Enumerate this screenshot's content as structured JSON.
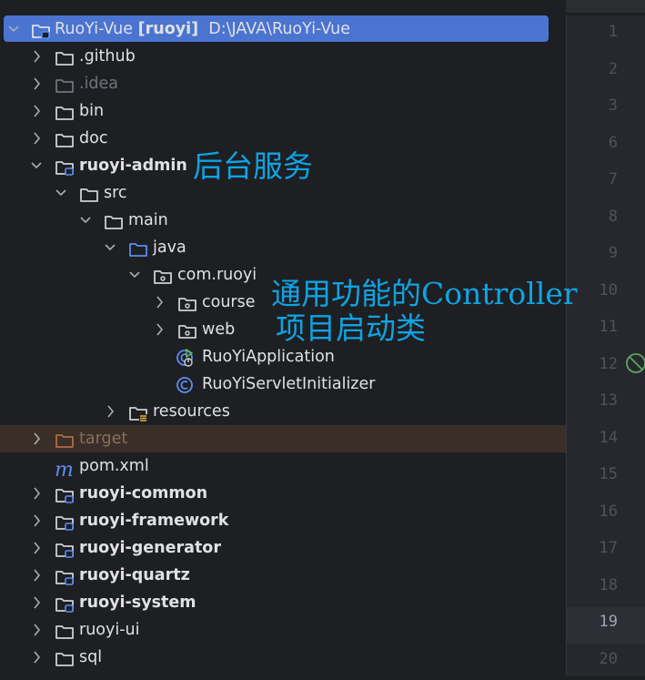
{
  "tree": {
    "root": {
      "name": "RuoYi-Vue",
      "module": "[ruoyi]",
      "path": "D:\\JAVA\\RuoYi-Vue"
    },
    "items": [
      {
        "label": ".github"
      },
      {
        "label": ".idea"
      },
      {
        "label": "bin"
      },
      {
        "label": "doc"
      },
      {
        "label": "ruoyi-admin"
      },
      {
        "label": "src"
      },
      {
        "label": "main"
      },
      {
        "label": "java"
      },
      {
        "label": "com.ruoyi"
      },
      {
        "label": "course"
      },
      {
        "label": "web"
      },
      {
        "label": "RuoYiApplication"
      },
      {
        "label": "RuoYiServletInitializer"
      },
      {
        "label": "resources"
      },
      {
        "label": "target"
      },
      {
        "label": "pom.xml"
      },
      {
        "label": "ruoyi-common"
      },
      {
        "label": "ruoyi-framework"
      },
      {
        "label": "ruoyi-generator"
      },
      {
        "label": "ruoyi-quartz"
      },
      {
        "label": "ruoyi-system"
      },
      {
        "label": "ruoyi-ui"
      },
      {
        "label": "sql"
      }
    ]
  },
  "annotations": {
    "backend": "后台服务",
    "common_prefix": "通用功能的",
    "common_suffix": "Controller",
    "startup": "项目启动类"
  },
  "gutter": {
    "lines": [
      "1",
      "2",
      "3",
      "6",
      "7",
      "8",
      "9",
      "10",
      "11",
      "12",
      "13",
      "14",
      "15",
      "16",
      "17",
      "18",
      "19",
      "20"
    ],
    "current_line": "19"
  },
  "colors": {
    "selection": "#4a74d0",
    "annotation": "#10a3e3",
    "excluded": "#3a2f28"
  }
}
